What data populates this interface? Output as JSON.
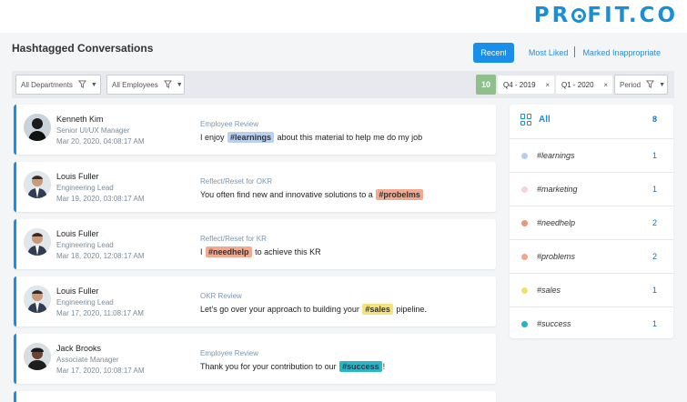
{
  "brand": {
    "logo_text_a": "PR",
    "logo_text_b": "FIT.CO",
    "accent": "#1a8fd6"
  },
  "page_title": "Hashtagged Conversations",
  "view_tabs": [
    {
      "label": "Recent",
      "active": true
    },
    {
      "label": "Most Liked",
      "active": false
    },
    {
      "label": "Marked Inappropriate",
      "active": false
    }
  ],
  "filters": {
    "departments": "All Departments",
    "employees": "All Employees",
    "count": "10",
    "chips": [
      "Q4 - 2019",
      "Q1 - 2020"
    ],
    "chip_remove": "×",
    "period": "Period"
  },
  "conversations": [
    {
      "name": "Kenneth Kim",
      "role": "Senior UI/UX Manager",
      "date": "Mar 20, 2020, 04:08:17 AM",
      "type": "Employee Review",
      "msg_before": "I enjoy",
      "tag": "#learnings",
      "tag_color": "#b9d0f0",
      "msg_after": "about this material to help me do my job"
    },
    {
      "name": "Louis Fuller",
      "role": "Engineering Lead",
      "date": "Mar 19, 2020, 03:08:17 AM",
      "type": "Reflect/Reset for OKR",
      "msg_before": "You often find new and innovative solutions to a",
      "tag": "#probelms",
      "tag_color": "#f2a98f",
      "msg_after": ""
    },
    {
      "name": "Louis Fuller",
      "role": "Engineering Lead",
      "date": "Mar 18, 2020, 12:08:17 AM",
      "type": "Reflect/Reset for KR",
      "msg_before": "I",
      "tag": "#needhelp",
      "tag_color": "#f2a98f",
      "msg_after": "to achieve this KR"
    },
    {
      "name": "Louis Fuller",
      "role": "Engineering Lead",
      "date": "Mar 17, 2020, 11:08:17 AM",
      "type": "OKR Review",
      "msg_before": "Let's go over your approach to building your",
      "tag": "#sales",
      "tag_color": "#f6e27a",
      "msg_after": "pipeline."
    },
    {
      "name": "Jack Brooks",
      "role": "Associate Manager",
      "date": "Mar 17, 2020, 10:08:17 AM",
      "type": "Employee Review",
      "msg_before": "Thank you for your contribution to our",
      "tag": "#success",
      "tag_color": "#2bb5c7",
      "msg_after": "!"
    }
  ],
  "tag_panel": {
    "all": {
      "label": "All",
      "count": "8"
    },
    "tags": [
      {
        "label": "#learnings",
        "count": "1",
        "color": "#b9cdf3"
      },
      {
        "label": "#marketing",
        "count": "1",
        "color": "#f9d4d6"
      },
      {
        "label": "#needhelp",
        "count": "2",
        "color": "#f0937d"
      },
      {
        "label": "#problems",
        "count": "2",
        "color": "#f2a58f"
      },
      {
        "label": "#sales",
        "count": "1",
        "color": "#f3e06a"
      },
      {
        "label": "#success",
        "count": "1",
        "color": "#25b2c2"
      }
    ]
  }
}
